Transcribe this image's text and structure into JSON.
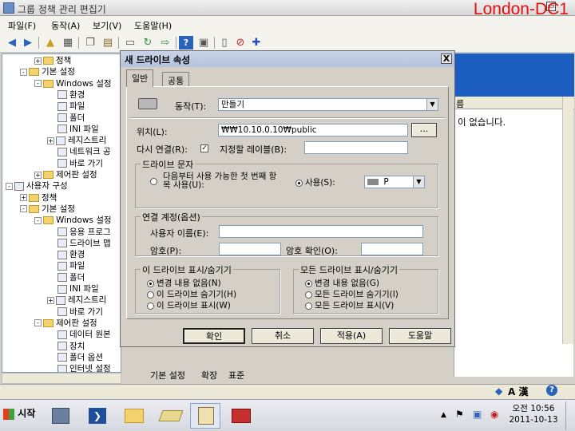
{
  "window": {
    "title": "그룹 정책 관리 편집기",
    "watermark": "London-DC1",
    "min_label": "▭"
  },
  "menu": [
    "파일(F)",
    "동작(A)",
    "보기(V)",
    "도움말(H)"
  ],
  "toolbar_icons": [
    "back-icon",
    "forward-icon",
    "up-folder-icon",
    "show-tree-icon",
    "copy-icon",
    "paste-icon",
    "export-icon",
    "refresh-icon",
    "export-list-icon",
    "help-icon",
    "properties-icon",
    "new-icon",
    "delete-icon",
    "add-icon"
  ],
  "tree": [
    {
      "label": "정책",
      "level": 2,
      "exp": "+",
      "kind": "folder"
    },
    {
      "label": "기본 설정",
      "level": 1,
      "exp": "-",
      "kind": "folder"
    },
    {
      "label": "Windows 설정",
      "level": 2,
      "exp": "-",
      "kind": "folder"
    },
    {
      "label": "환경",
      "level": 3,
      "exp": "",
      "kind": "item"
    },
    {
      "label": "파일",
      "level": 3,
      "exp": "",
      "kind": "item"
    },
    {
      "label": "폴더",
      "level": 3,
      "exp": "",
      "kind": "item"
    },
    {
      "label": "INI 파일",
      "level": 3,
      "exp": "",
      "kind": "item"
    },
    {
      "label": "레지스트리",
      "level": 3,
      "exp": "+",
      "kind": "item"
    },
    {
      "label": "네트워크 공",
      "level": 3,
      "exp": "",
      "kind": "item"
    },
    {
      "label": "바로 가기",
      "level": 3,
      "exp": "",
      "kind": "item"
    },
    {
      "label": "제어판 설정",
      "level": 2,
      "exp": "+",
      "kind": "folder"
    },
    {
      "label": "사용자 구성",
      "level": 0,
      "exp": "-",
      "kind": "item"
    },
    {
      "label": "정책",
      "level": 1,
      "exp": "+",
      "kind": "folder"
    },
    {
      "label": "기본 설정",
      "level": 1,
      "exp": "-",
      "kind": "folder"
    },
    {
      "label": "Windows 설정",
      "level": 2,
      "exp": "-",
      "kind": "folder"
    },
    {
      "label": "응용 프로그",
      "level": 3,
      "exp": "",
      "kind": "item"
    },
    {
      "label": "드라이브 맵",
      "level": 3,
      "exp": "",
      "kind": "item"
    },
    {
      "label": "환경",
      "level": 3,
      "exp": "",
      "kind": "item"
    },
    {
      "label": "파일",
      "level": 3,
      "exp": "",
      "kind": "item"
    },
    {
      "label": "폴더",
      "level": 3,
      "exp": "",
      "kind": "item"
    },
    {
      "label": "INI 파일",
      "level": 3,
      "exp": "",
      "kind": "item"
    },
    {
      "label": "레지스트리",
      "level": 3,
      "exp": "+",
      "kind": "item"
    },
    {
      "label": "바로 가기",
      "level": 3,
      "exp": "",
      "kind": "item"
    },
    {
      "label": "제어판 설정",
      "level": 2,
      "exp": "-",
      "kind": "folder"
    },
    {
      "label": "데이터 원본",
      "level": 3,
      "exp": "",
      "kind": "item"
    },
    {
      "label": "장치",
      "level": 3,
      "exp": "",
      "kind": "item"
    },
    {
      "label": "폴더 옵션",
      "level": 3,
      "exp": "",
      "kind": "item"
    },
    {
      "label": "인터넷 설정",
      "level": 3,
      "exp": "",
      "kind": "item"
    }
  ],
  "right_pane": {
    "column_header": "름",
    "empty_message": "이 없습니다."
  },
  "bottom_tabs": [
    "기본 설정",
    "확장",
    "표준"
  ],
  "dialog": {
    "title": "새 드라이브 속성",
    "close": "X",
    "tabs": [
      "일반",
      "공통"
    ],
    "action_label": "동작(T):",
    "action_value": "만들기",
    "location_label": "위치(L):",
    "location_value": "₩₩10.10.0.10₩public",
    "browse": "...",
    "reconnect_label": "다시 연결(R):",
    "reconnect_checked": "✓",
    "label_as": "지정할 레이블(B):",
    "label_value": "",
    "drive_letter_group": "드라이브 문자",
    "first_available": "다음부터 사용 가능한 첫 번째 항목 사용(U):",
    "use_label": "사용(S):",
    "drive_value": "P",
    "connect_as_group": "연결 계정(옵션)",
    "username_label": "사용자 이름(E):",
    "password_label": "암호(P):",
    "confirm_password_label": "암호 확인(O):",
    "hide_this_group": "이 드라이브 표시/숨기기",
    "hide_this_options": [
      "변경 내용 없음(N)",
      "이 드라이브 숨기기(H)",
      "이 드라이브 표시(W)"
    ],
    "hide_all_group": "모든 드라이브 표시/숨기기",
    "hide_all_options": [
      "변경 내용 없음(G)",
      "모든 드라이브 숨기기(I)",
      "모든 드라이브 표시(V)"
    ],
    "buttons": {
      "ok": "확인",
      "cancel": "취소",
      "apply": "적용(A)",
      "help": "도움말"
    }
  },
  "statusbar": {
    "lang": "A 漢"
  },
  "taskbar": {
    "start": "시작",
    "time": "오전 10:56",
    "date": "2011-10-13"
  }
}
